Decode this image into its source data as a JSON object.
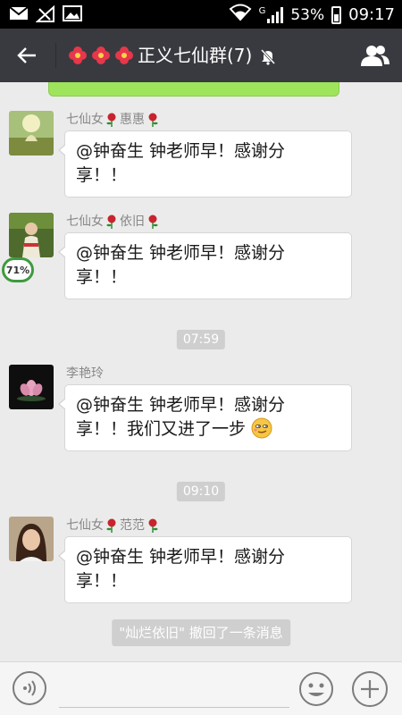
{
  "status_bar": {
    "battery": "53%",
    "time": "09:17",
    "network_type": "G",
    "icons": [
      "mail-icon",
      "no-signal-sim-icon",
      "image-icon",
      "wifi-icon",
      "signal-icon",
      "battery-icon"
    ]
  },
  "header": {
    "title": "正义七仙群(7)",
    "title_prefix_icons": [
      "hibiscus-icon",
      "hibiscus-icon",
      "hibiscus-icon"
    ],
    "muted": true
  },
  "messages": [
    {
      "sender_prefix": "七仙女",
      "sender_name": "惠惠",
      "text_line1": "@钟奋生 钟老师早！感谢分",
      "text_line2": "享！！"
    },
    {
      "sender_prefix": "七仙女",
      "sender_name": "依旧",
      "text_line1": "@钟奋生 钟老师早！感谢分",
      "text_line2": "享！！",
      "progress": "71%"
    },
    {
      "timestamp": "07:59"
    },
    {
      "sender_prefix": "",
      "sender_name": "李艳玲",
      "text_line1": "@钟奋生 钟老师早！感谢分",
      "text_line2": "享！！我们又进了一步"
    },
    {
      "timestamp": "09:10"
    },
    {
      "sender_prefix": "七仙女",
      "sender_name": "范范",
      "text_line1": "@钟奋生 钟老师早！感谢分",
      "text_line2": "享！！"
    }
  ],
  "system_notice": "\"灿烂依旧\" 撤回了一条消息",
  "colors": {
    "header_bg": "#393a3f",
    "chat_bg": "#ebebeb",
    "green_bubble": "#9ee55b",
    "progress_ring": "#3e9a3e"
  }
}
